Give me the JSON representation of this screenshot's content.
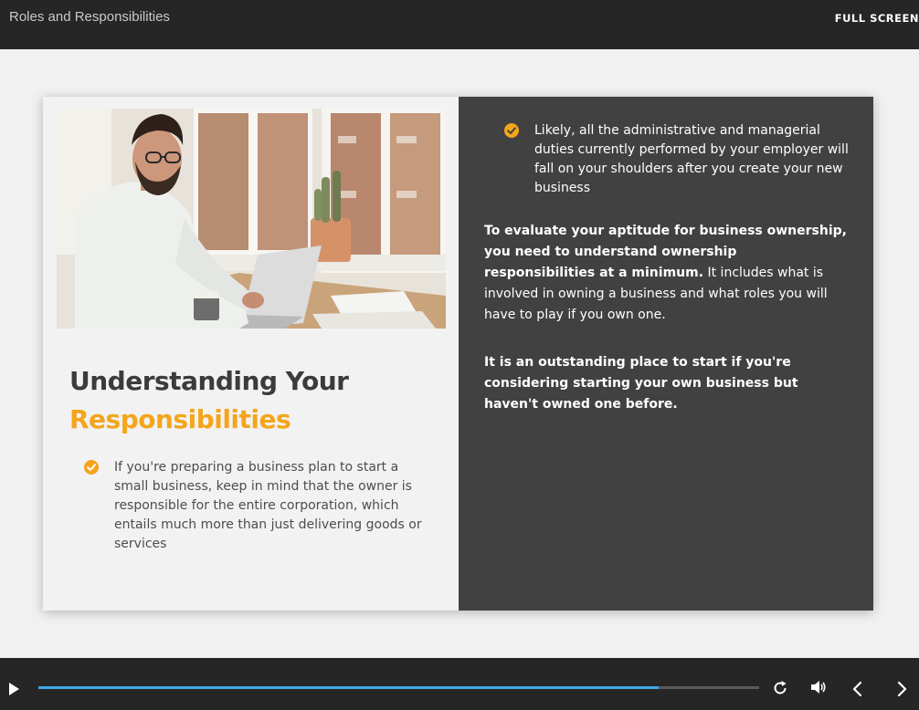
{
  "header": {
    "title": "Roles and Responsibilities",
    "fullscreen_label": "FULL SCREEN"
  },
  "slide": {
    "heading_line1": "Understanding Your",
    "heading_line2": "Responsibilities",
    "left_bullet": "If you're preparing a business plan to start a small business, keep in mind that the owner is responsible for the entire corporation, which entails much more than just delivering goods or services",
    "right_bullet": "Likely, all the administrative and managerial duties currently performed by your employer will fall on your shoulders after you create your new business",
    "para1_bold": "To evaluate your aptitude for business ownership, you need to understand ownership responsibilities at a minimum.",
    "para1_rest": " It includes what is involved in owning a business and what roles you will have to play if you own one.",
    "para2": "It is an outstanding place to start if you're considering starting your own business but haven't owned one before."
  },
  "player": {
    "progress": 0.86
  },
  "icons": {
    "bullet": "check-circle-icon",
    "play": "play-icon",
    "replay": "replay-icon",
    "volume": "volume-icon",
    "prev": "chevron-left-icon",
    "next": "chevron-right-icon"
  },
  "colors": {
    "accent": "#f4a51c",
    "progress": "#3fa7ea",
    "dark_panel": "#414141",
    "bar": "#262626"
  }
}
